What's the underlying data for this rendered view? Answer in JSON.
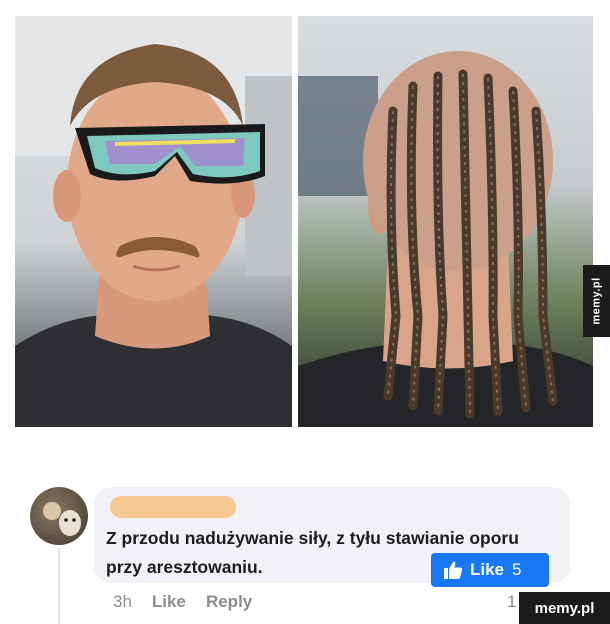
{
  "watermark": {
    "side": "memy.pl",
    "corner": "memy.pl"
  },
  "comment": {
    "author_redacted": "",
    "text": "Z przodu nadużywanie siły, z tyłu stawianie oporu przy aresztowaniu.",
    "like_badge": {
      "label": "Like",
      "count": "5"
    },
    "actions": {
      "time": "3h",
      "like": "Like",
      "reply": "Reply"
    },
    "trailing": "1"
  },
  "colors": {
    "like_blue": "#1877f2",
    "bubble": "#f0f2f5",
    "redaction": "#f6c993"
  },
  "icons": [
    "thumbs-up-icon"
  ]
}
